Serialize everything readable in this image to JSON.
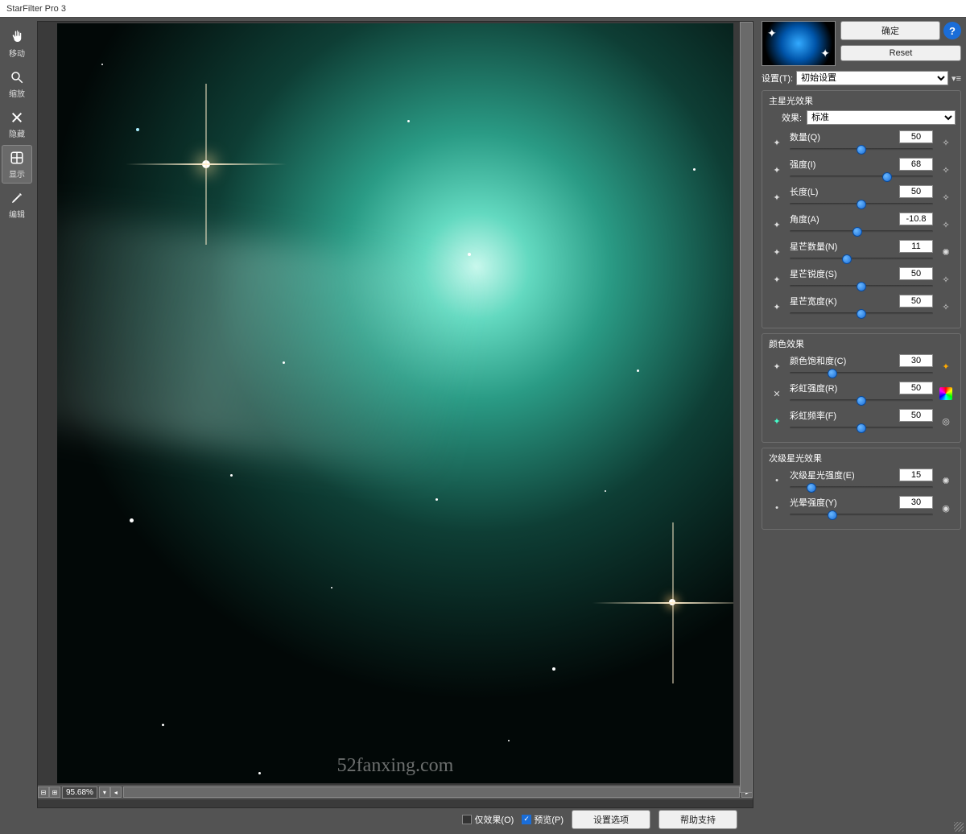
{
  "window": {
    "title": "StarFilter Pro 3"
  },
  "toolbar": {
    "move": "移动",
    "zoom": "缩放",
    "hide": "隐藏",
    "show": "显示",
    "edit": "编辑"
  },
  "canvas": {
    "zoom": "95.68%",
    "watermark": "52fanxing.com"
  },
  "bottom": {
    "only_effect": "仅效果(O)",
    "preview": "预览(P)",
    "settings_btn": "设置选项",
    "help_btn": "帮助支持"
  },
  "side": {
    "ok": "确定",
    "reset": "Reset",
    "preset_label": "设置(T):",
    "preset_value": "初始设置"
  },
  "panel1": {
    "title": "主星光效果",
    "effect_label": "效果:",
    "effect_value": "标准",
    "quantity": {
      "label": "数量(Q)",
      "value": "50",
      "pct": 50
    },
    "intensity": {
      "label": "强度(I)",
      "value": "68",
      "pct": 68
    },
    "length": {
      "label": "长度(L)",
      "value": "50",
      "pct": 50
    },
    "angle": {
      "label": "角度(A)",
      "value": "-10.8",
      "pct": 47
    },
    "spikes": {
      "label": "星芒数量(N)",
      "value": "11",
      "pct": 40
    },
    "sharpness": {
      "label": "星芒锐度(S)",
      "value": "50",
      "pct": 50
    },
    "width": {
      "label": "星芒宽度(K)",
      "value": "50",
      "pct": 50
    }
  },
  "panel2": {
    "title": "颜色效果",
    "saturation": {
      "label": "颜色饱和度(C)",
      "value": "30",
      "pct": 30
    },
    "rainbow_int": {
      "label": "彩虹强度(R)",
      "value": "50",
      "pct": 50
    },
    "rainbow_freq": {
      "label": "彩虹频率(F)",
      "value": "50",
      "pct": 50
    }
  },
  "panel3": {
    "title": "次级星光效果",
    "sec_intensity": {
      "label": "次级星光强度(E)",
      "value": "15",
      "pct": 15
    },
    "glow": {
      "label": "光晕强度(Y)",
      "value": "30",
      "pct": 30
    }
  }
}
